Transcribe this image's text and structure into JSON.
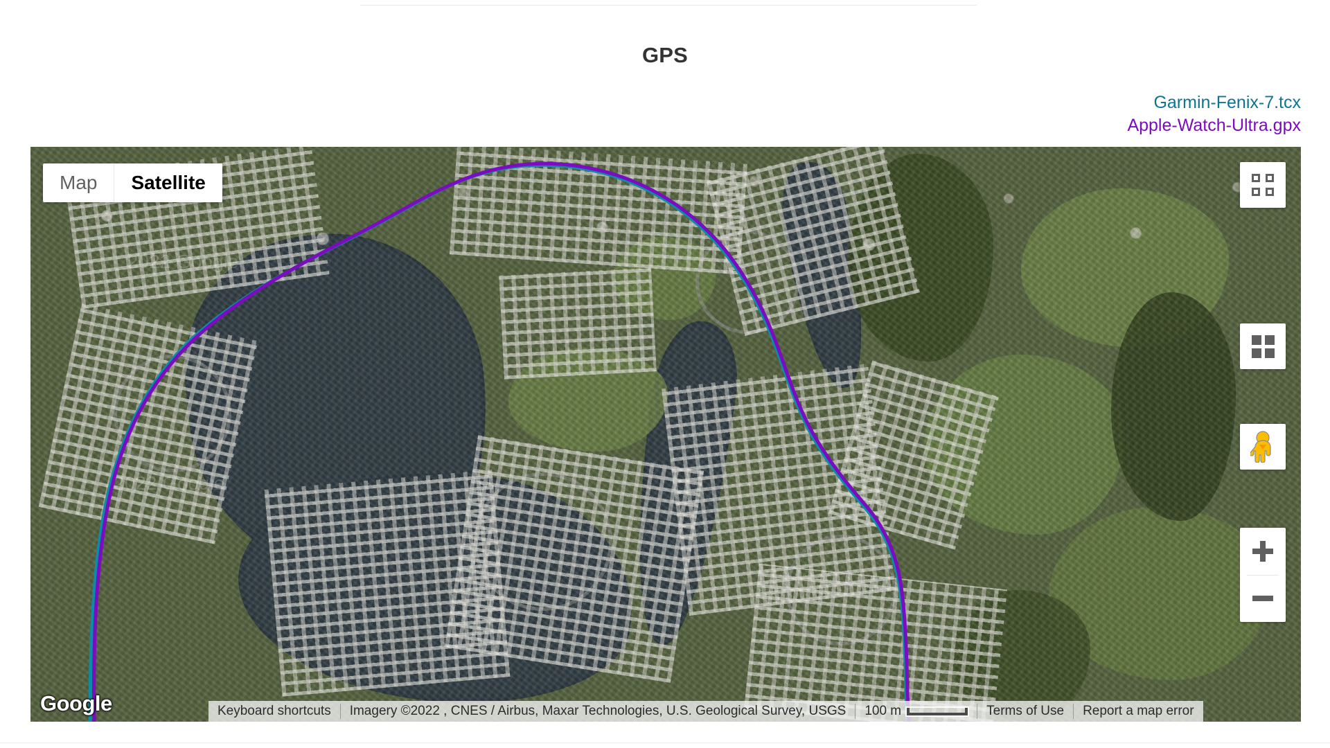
{
  "page": {
    "title": "GPS"
  },
  "legend": {
    "items": [
      {
        "label": "Garmin-Fenix-7.tcx",
        "color": "#0e7490"
      },
      {
        "label": "Apple-Watch-Ultra.gpx",
        "color": "#7b0cc0"
      }
    ]
  },
  "map": {
    "type_control": {
      "map_label": "Map",
      "satellite_label": "Satellite",
      "active": "Satellite"
    },
    "controls": {
      "fullscreen": "fullscreen-icon",
      "tilt": "grid-icon",
      "pegman": "pegman-icon",
      "zoom_in": "plus-icon",
      "zoom_out": "minus-icon"
    },
    "logo": "Google",
    "attribution": {
      "keyboard_shortcuts": "Keyboard shortcuts",
      "imagery": "Imagery ©2022 , CNES / Airbus, Maxar Technologies, U.S. Geological Survey, USGS",
      "scale_label": "100 m",
      "terms": "Terms of Use",
      "report": "Report a map error"
    },
    "watermark": "2022 Google"
  }
}
